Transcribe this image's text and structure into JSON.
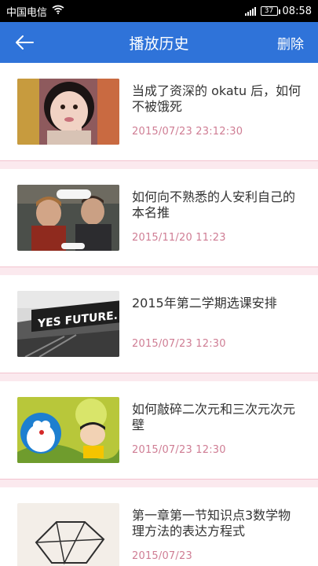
{
  "status_bar": {
    "carrier": "中国电信",
    "battery": "37",
    "time": "08:58"
  },
  "app_bar": {
    "title": "播放历史",
    "delete_label": "删除"
  },
  "items": [
    {
      "title": "当成了资深的 okatu 后，如何不被饿死",
      "date": "2015/07/23   23:12:30"
    },
    {
      "title": "如何向不熟悉的人安利自己的本名推",
      "date": "2015/11/20   11:23"
    },
    {
      "title": "2015年第二学期选课安排",
      "date": "2015/07/23   12:30"
    },
    {
      "title": "如何敲碎二次元和三次元次元壁",
      "date": "2015/07/23   12:30"
    },
    {
      "title": "第一章第一节知识点3数学物理方法的表达方程式",
      "date": "2015/07/23"
    }
  ],
  "thumbnail_texts": {
    "yes_future": "YES FUTURE."
  },
  "colors": {
    "accent": "#2f73d9",
    "date": "#cf7d94",
    "separator": "#fbe9ee"
  }
}
